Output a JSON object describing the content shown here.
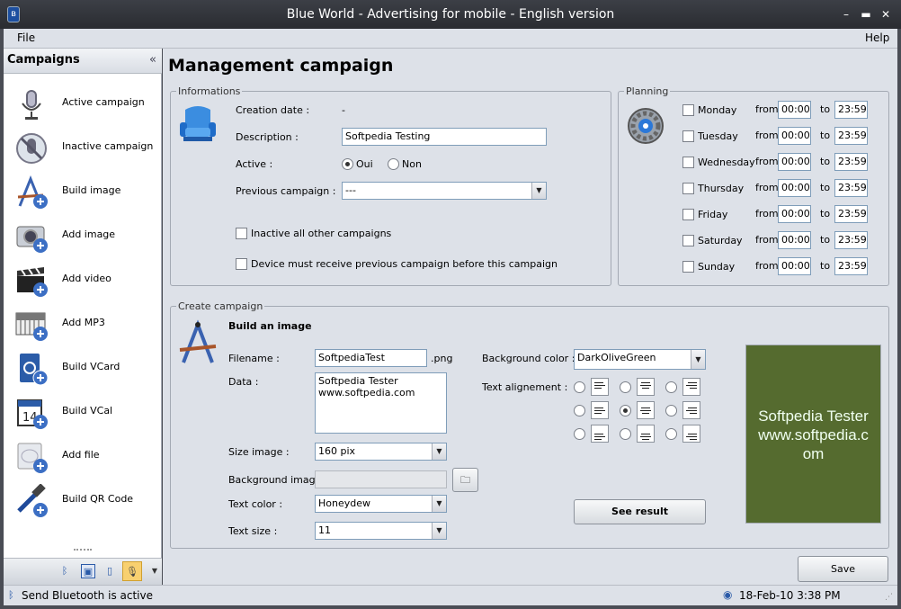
{
  "window": {
    "title": "Blue World - Advertising for mobile - English version"
  },
  "menu": {
    "file": "File",
    "help": "Help"
  },
  "sidebar": {
    "title": "Campaigns",
    "items": [
      {
        "label": "Active campaign",
        "icon": "microphone-icon"
      },
      {
        "label": "Inactive campaign",
        "icon": "microphone-muted-icon"
      },
      {
        "label": "Build image",
        "icon": "draw-tools-add-icon"
      },
      {
        "label": "Add image",
        "icon": "camera-add-icon"
      },
      {
        "label": "Add video",
        "icon": "clapperboard-add-icon"
      },
      {
        "label": "Add MP3",
        "icon": "piano-add-icon"
      },
      {
        "label": "Build VCard",
        "icon": "vcard-add-icon"
      },
      {
        "label": "Build VCal",
        "icon": "calendar-add-icon"
      },
      {
        "label": "Add file",
        "icon": "file-add-icon"
      },
      {
        "label": "Build QR Code",
        "icon": "tools-add-icon"
      }
    ]
  },
  "main": {
    "title": "Management campaign",
    "informations": {
      "legend": "Informations",
      "creation_date_label": "Creation date :",
      "creation_date_value": "-",
      "description_label": "Description :",
      "description_value": "Softpedia Testing",
      "active_label": "Active :",
      "active_yes": "Oui",
      "active_no": "Non",
      "active_selected": "Oui",
      "previous_label": "Previous campaign :",
      "previous_value": "---",
      "inactive_all_label": "Inactive all other campaigns",
      "device_must_label": "Device must receive previous campaign before this campaign"
    },
    "planning": {
      "legend": "Planning",
      "from_label": "from",
      "to_label": "to",
      "days": [
        {
          "day": "Monday",
          "from": "00:00",
          "to": "23:59"
        },
        {
          "day": "Tuesday",
          "from": "00:00",
          "to": "23:59"
        },
        {
          "day": "Wednesday",
          "from": "00:00",
          "to": "23:59"
        },
        {
          "day": "Thursday",
          "from": "00:00",
          "to": "23:59"
        },
        {
          "day": "Friday",
          "from": "00:00",
          "to": "23:59"
        },
        {
          "day": "Saturday",
          "from": "00:00",
          "to": "23:59"
        },
        {
          "day": "Sunday",
          "from": "00:00",
          "to": "23:59"
        }
      ]
    },
    "create": {
      "legend": "Create campaign",
      "heading": "Build an image",
      "filename_label": "Filename :",
      "filename_value": "SoftpediaTest",
      "filename_ext": ".png",
      "data_label": "Data :",
      "data_line1": "Softpedia Tester",
      "data_line2": "www.softpedia.com",
      "size_label": "Size image :",
      "size_value": "160 pix",
      "bgimage_label": "Background image :",
      "textcolor_label": "Text color :",
      "textcolor_value": "Honeydew",
      "textsize_label": "Text size :",
      "textsize_value": "11",
      "bgcolor_label": "Background color :",
      "bgcolor_value": "DarkOliveGreen",
      "align_label": "Text alignement :",
      "align_selected": "middle-center",
      "see_result": "See result",
      "preview_line1": "Softpedia Tester",
      "preview_line2": "www.softpedia.c",
      "preview_line3": "om",
      "preview_bg": "#556b2f",
      "preview_fg": "#f0fff0"
    },
    "save": "Save"
  },
  "status": {
    "message": "Send Bluetooth is active",
    "datetime": "18-Feb-10 3:38 PM"
  }
}
